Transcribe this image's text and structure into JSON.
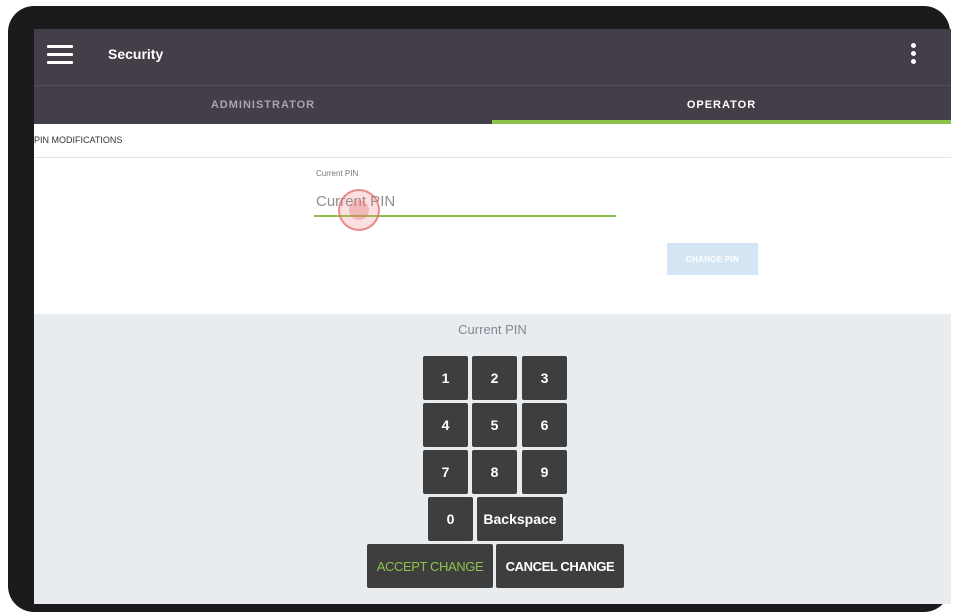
{
  "appbar": {
    "title": "Security",
    "menu_icon": "hamburger-menu-icon",
    "overflow_icon": "more-vertical-icon"
  },
  "tabs": [
    {
      "label": "ADMINISTRATOR",
      "selected": false
    },
    {
      "label": "OPERATOR",
      "selected": true
    }
  ],
  "form": {
    "section_label": "PIN MODIFICATIONS",
    "current_pin": {
      "caption": "Current PIN",
      "placeholder": "Current PIN",
      "value": ""
    },
    "change_pin_label": "CHANGE PIN"
  },
  "keypad": {
    "title": "Current PIN",
    "keys": [
      "1",
      "2",
      "3",
      "4",
      "5",
      "6",
      "7",
      "8",
      "9"
    ],
    "zero_label": "0",
    "backspace_label": "Backspace",
    "accept_label": "ACCEPT CHANGE",
    "cancel_label": "CANCEL CHANGE"
  },
  "colors": {
    "appbar": "#433e47",
    "accent": "#8bc34a",
    "key": "#3e3e3e",
    "keypad_bg": "#e9ecef"
  }
}
